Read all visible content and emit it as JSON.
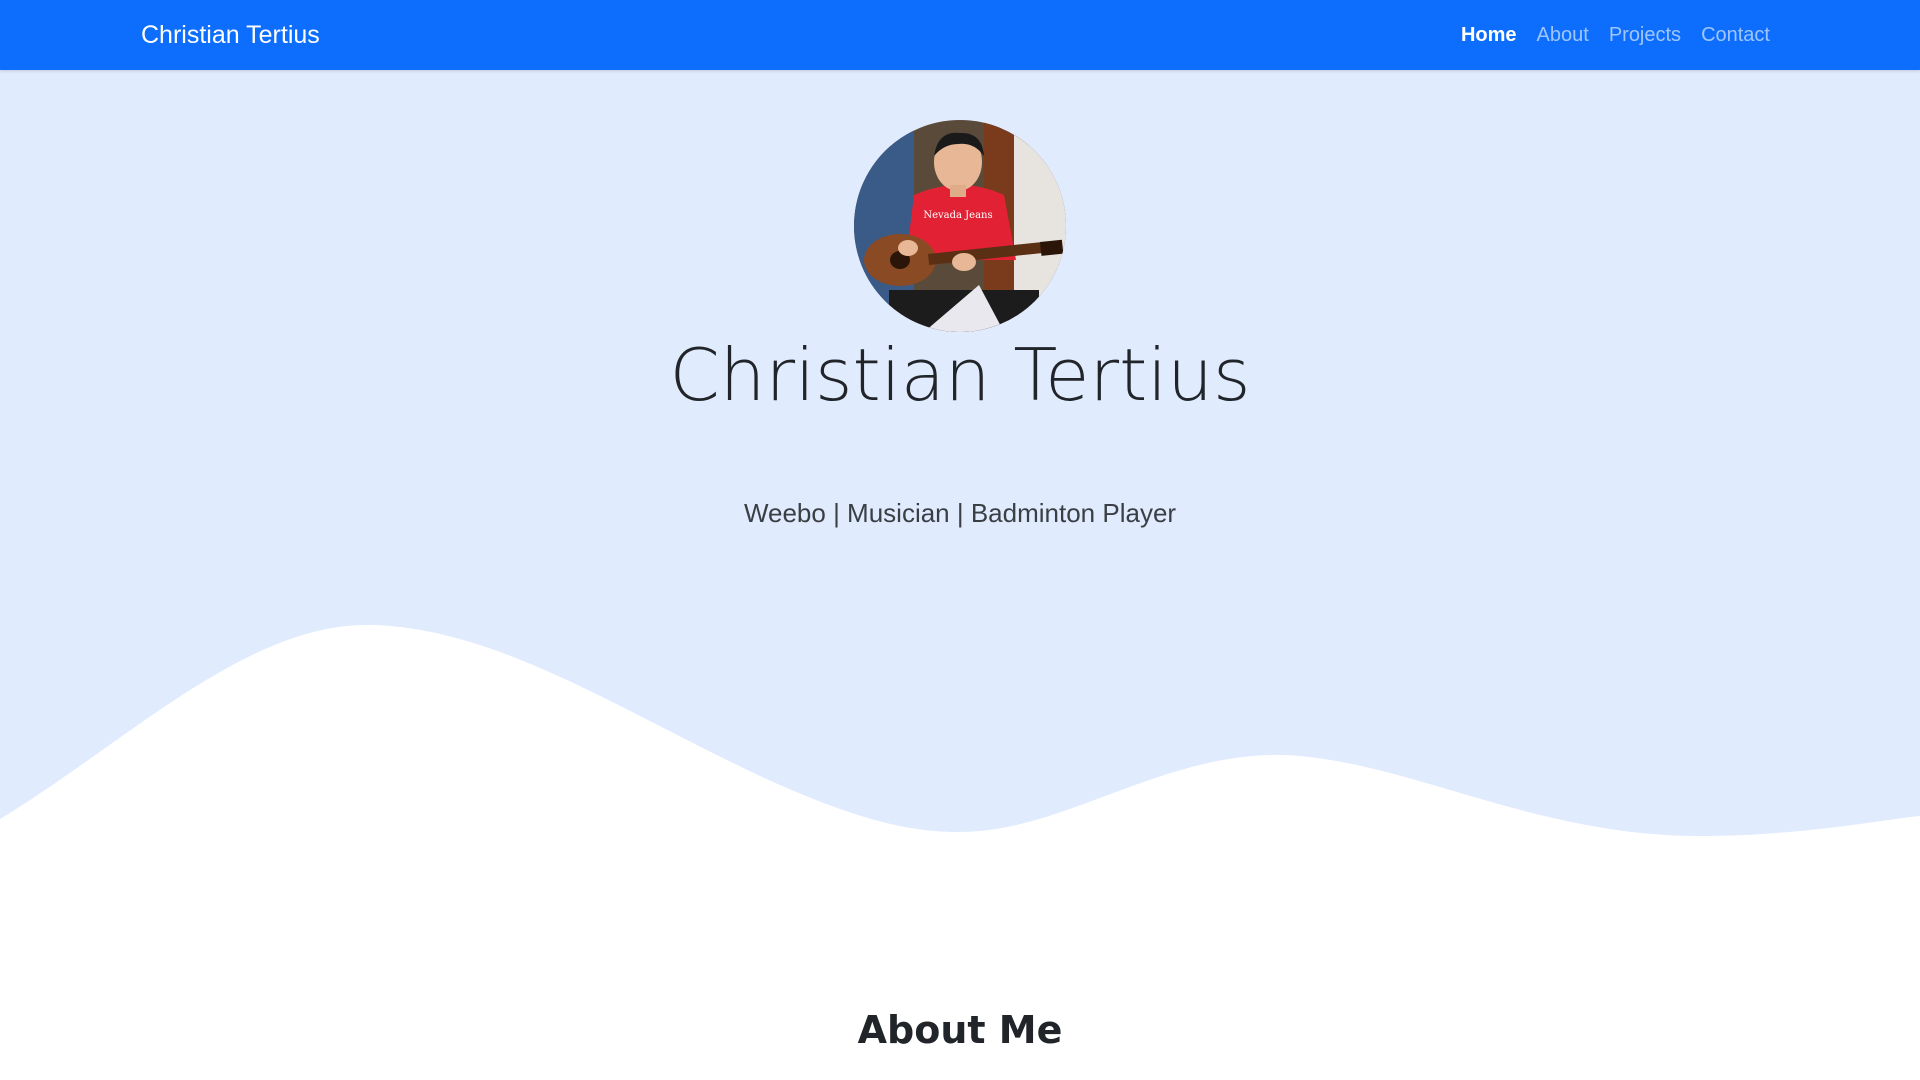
{
  "navbar": {
    "brand": "Christian Tertius",
    "links": [
      {
        "label": "Home",
        "active": true
      },
      {
        "label": "About",
        "active": false
      },
      {
        "label": "Projects",
        "active": false
      },
      {
        "label": "Contact",
        "active": false
      }
    ]
  },
  "hero": {
    "avatar_icon": "profile-photo",
    "name": "Christian Tertius",
    "tagline": "Weebo | Musician | Badminton Player"
  },
  "about": {
    "title": "About Me"
  },
  "colors": {
    "navbar": "#0d6efd",
    "hero_bg": "#e0ebfe",
    "wave": "#ffffff"
  }
}
